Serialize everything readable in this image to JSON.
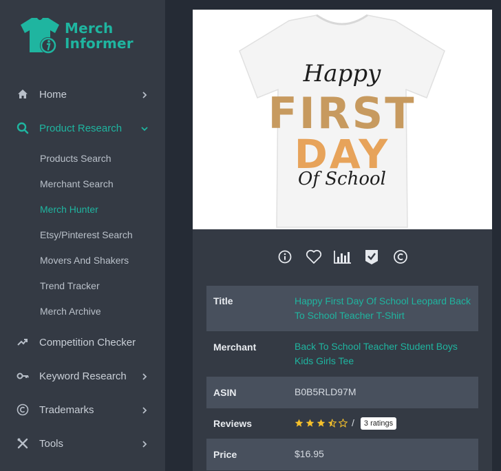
{
  "brand": {
    "line1": "Merch",
    "line2": "Informer",
    "accent": "#1fb5a0"
  },
  "nav": {
    "home": "Home",
    "product_research": "Product Research",
    "sub": [
      "Products Search",
      "Merchant Search",
      "Merch Hunter",
      "Etsy/Pinterest Search",
      "Movers And Shakers",
      "Trend Tracker",
      "Merch Archive"
    ],
    "competition": "Competition Checker",
    "keyword": "Keyword Research",
    "trademarks": "Trademarks",
    "tools": "Tools"
  },
  "shirt_art": {
    "line1": "Happy",
    "line2": "FIRST",
    "line3": "DAY",
    "line4": "Of School"
  },
  "product": {
    "title_label": "Title",
    "title": "Happy First Day Of School Leopard Back To School Teacher T-Shirt",
    "merchant_label": "Merchant",
    "merchant": "Back To School Teacher Student Boys Kids Girls Tee",
    "asin_label": "ASIN",
    "asin": "B0B5RLD97M",
    "reviews_label": "Reviews",
    "rating": 3.5,
    "ratings_count": "3 ratings",
    "slash": "/",
    "price_label": "Price",
    "price": "$16.95"
  }
}
